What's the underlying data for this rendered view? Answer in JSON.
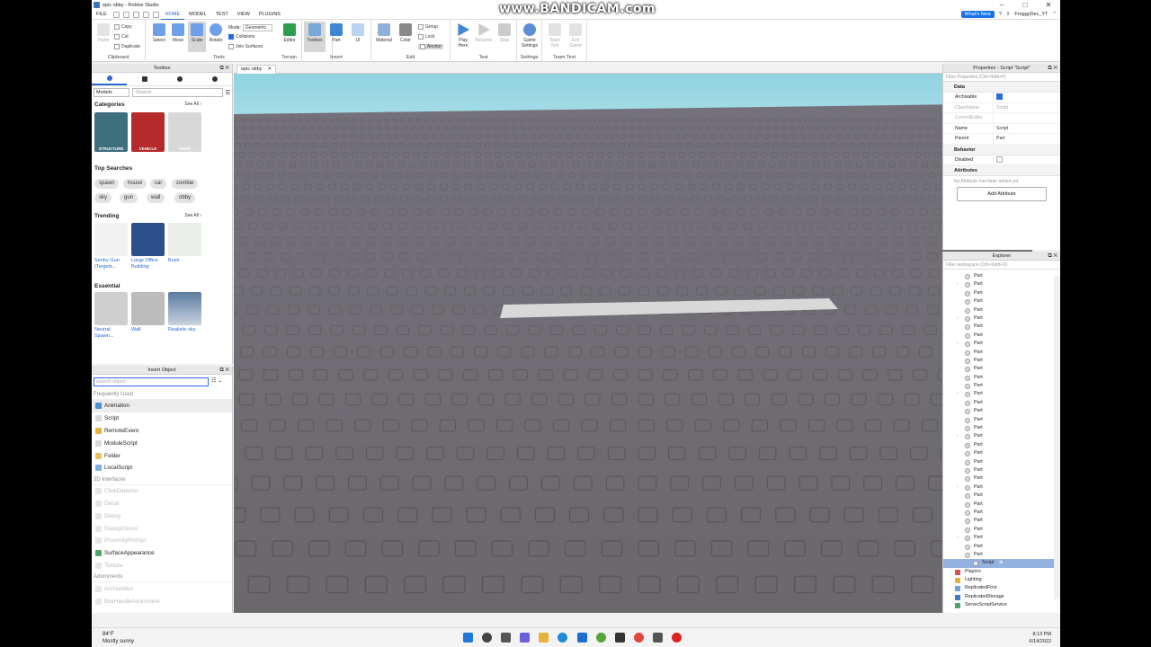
{
  "watermark": "www.BANDICAM.com",
  "window": {
    "title": "epic obby - Roblox Studio",
    "min": "–",
    "max": "□",
    "close": "✕"
  },
  "menubar": {
    "items": [
      "FILE",
      "HOME",
      "MODEL",
      "TEST",
      "VIEW",
      "PLUGINS"
    ],
    "active": "HOME",
    "whats_new": "What's New",
    "user": "FroggyDev_YT"
  },
  "ribbon": {
    "clipboard": {
      "paste": "Paste",
      "copy": "Copy",
      "cut": "Cut",
      "duplicate": "Duplicate",
      "label": "Clipboard"
    },
    "tools": {
      "select": "Select",
      "move": "Move",
      "scale": "Scale",
      "rotate": "Rotate",
      "mode_label": "Mode:",
      "mode_value": "Geometric",
      "collisions": "Collisions",
      "join_surfaces": "Join Surfaces",
      "label": "Tools"
    },
    "terrain": {
      "editor": "Editor",
      "label": "Terrain"
    },
    "insert": {
      "toolbox": "Toolbox",
      "part": "Part",
      "ui": "UI",
      "label": "Insert"
    },
    "edit": {
      "material": "Material",
      "color": "Color",
      "group": "Group",
      "lock": "Lock",
      "anchor": "Anchor",
      "label": "Edit"
    },
    "test": {
      "play": "Play",
      "play_here": "Here",
      "resume": "Resume",
      "stop": "Stop",
      "label": "Test"
    },
    "settings": {
      "game": "Game",
      "game2": "Settings",
      "label": "Settings"
    },
    "teamtest": {
      "team": "Team",
      "team2": "Test",
      "exit": "Exit",
      "exit2": "Game",
      "label": "Team Test"
    }
  },
  "toolbox": {
    "title": "Toolbox",
    "category_select": "Models",
    "search_placeholder": "Search",
    "categories_title": "Categories",
    "see_all": "See All ›",
    "categories": [
      "STRUCTURE",
      "VEHICLE",
      "SHOP"
    ],
    "top_searches_title": "Top Searches",
    "top_searches": [
      "spawn",
      "house",
      "car",
      "zombie",
      "sky",
      "gun",
      "wall",
      "obby"
    ],
    "trending_title": "Trending",
    "trending": [
      {
        "l1": "Sentry Gun",
        "l2": "(Targets..."
      },
      {
        "l1": "Large Office",
        "l2": "Building"
      },
      {
        "l1": "Bush",
        "l2": ""
      }
    ],
    "essential_title": "Essential",
    "essential": [
      {
        "l1": "Neutral",
        "l2": "Spawn..."
      },
      {
        "l1": "Wall",
        "l2": ""
      },
      {
        "l1": "Realistic sky",
        "l2": ""
      }
    ]
  },
  "insert_object": {
    "title": "Insert Object",
    "search_placeholder": "search object",
    "frequently_used": "Frequently Used",
    "frequent": [
      "Animation",
      "Script",
      "RemoteEvent",
      "ModuleScript",
      "Folder",
      "LocalScript"
    ],
    "ui_3d": "3D Interfaces",
    "ui_items": [
      {
        "n": "ClickDetector",
        "dim": true
      },
      {
        "n": "Decal",
        "dim": true
      },
      {
        "n": "Dialog",
        "dim": true
      },
      {
        "n": "DialogChoice",
        "dim": true
      },
      {
        "n": "ProximityPrompt",
        "dim": true
      },
      {
        "n": "SurfaceAppearance",
        "dim": false
      },
      {
        "n": "Texture",
        "dim": true
      }
    ],
    "adornments": "Adornments",
    "adorn_items": [
      "ArcHandles",
      "BoxHandleAdornment"
    ]
  },
  "document": {
    "tab": "epic obby",
    "close": "✕"
  },
  "properties": {
    "title": "Properties - Script \"Script\"",
    "filter": "Filter Properties (Ctrl+Shift+P)",
    "data": "Data",
    "archivable": "Archivable",
    "classname_k": "ClassName",
    "classname_v": "Script",
    "currenteditor": "CurrentEditor",
    "name_k": "Name",
    "name_v": "Script",
    "parent_k": "Parent",
    "parent_v": "Part",
    "behavior": "Behavior",
    "disabled": "Disabled",
    "attributes": "Attributes",
    "no_attr": "No Attribute has been added yet",
    "add_attr": "Add Attribute"
  },
  "explorer": {
    "title": "Explorer",
    "filter": "Filter workspace (Ctrl+Shift+X)",
    "part_label": "Part",
    "expanded_rows": [
      1,
      5,
      8,
      14,
      19,
      25,
      31
    ],
    "part_count": 34,
    "script": "Script",
    "services": [
      "Players",
      "Lighting",
      "ReplicatedFirst",
      "ReplicatedStorage",
      "ServerScriptService"
    ]
  },
  "taskbar": {
    "temp": "84°F",
    "weather": "Mostly sunny",
    "time": "8:13 PM",
    "date": "6/14/2022"
  }
}
